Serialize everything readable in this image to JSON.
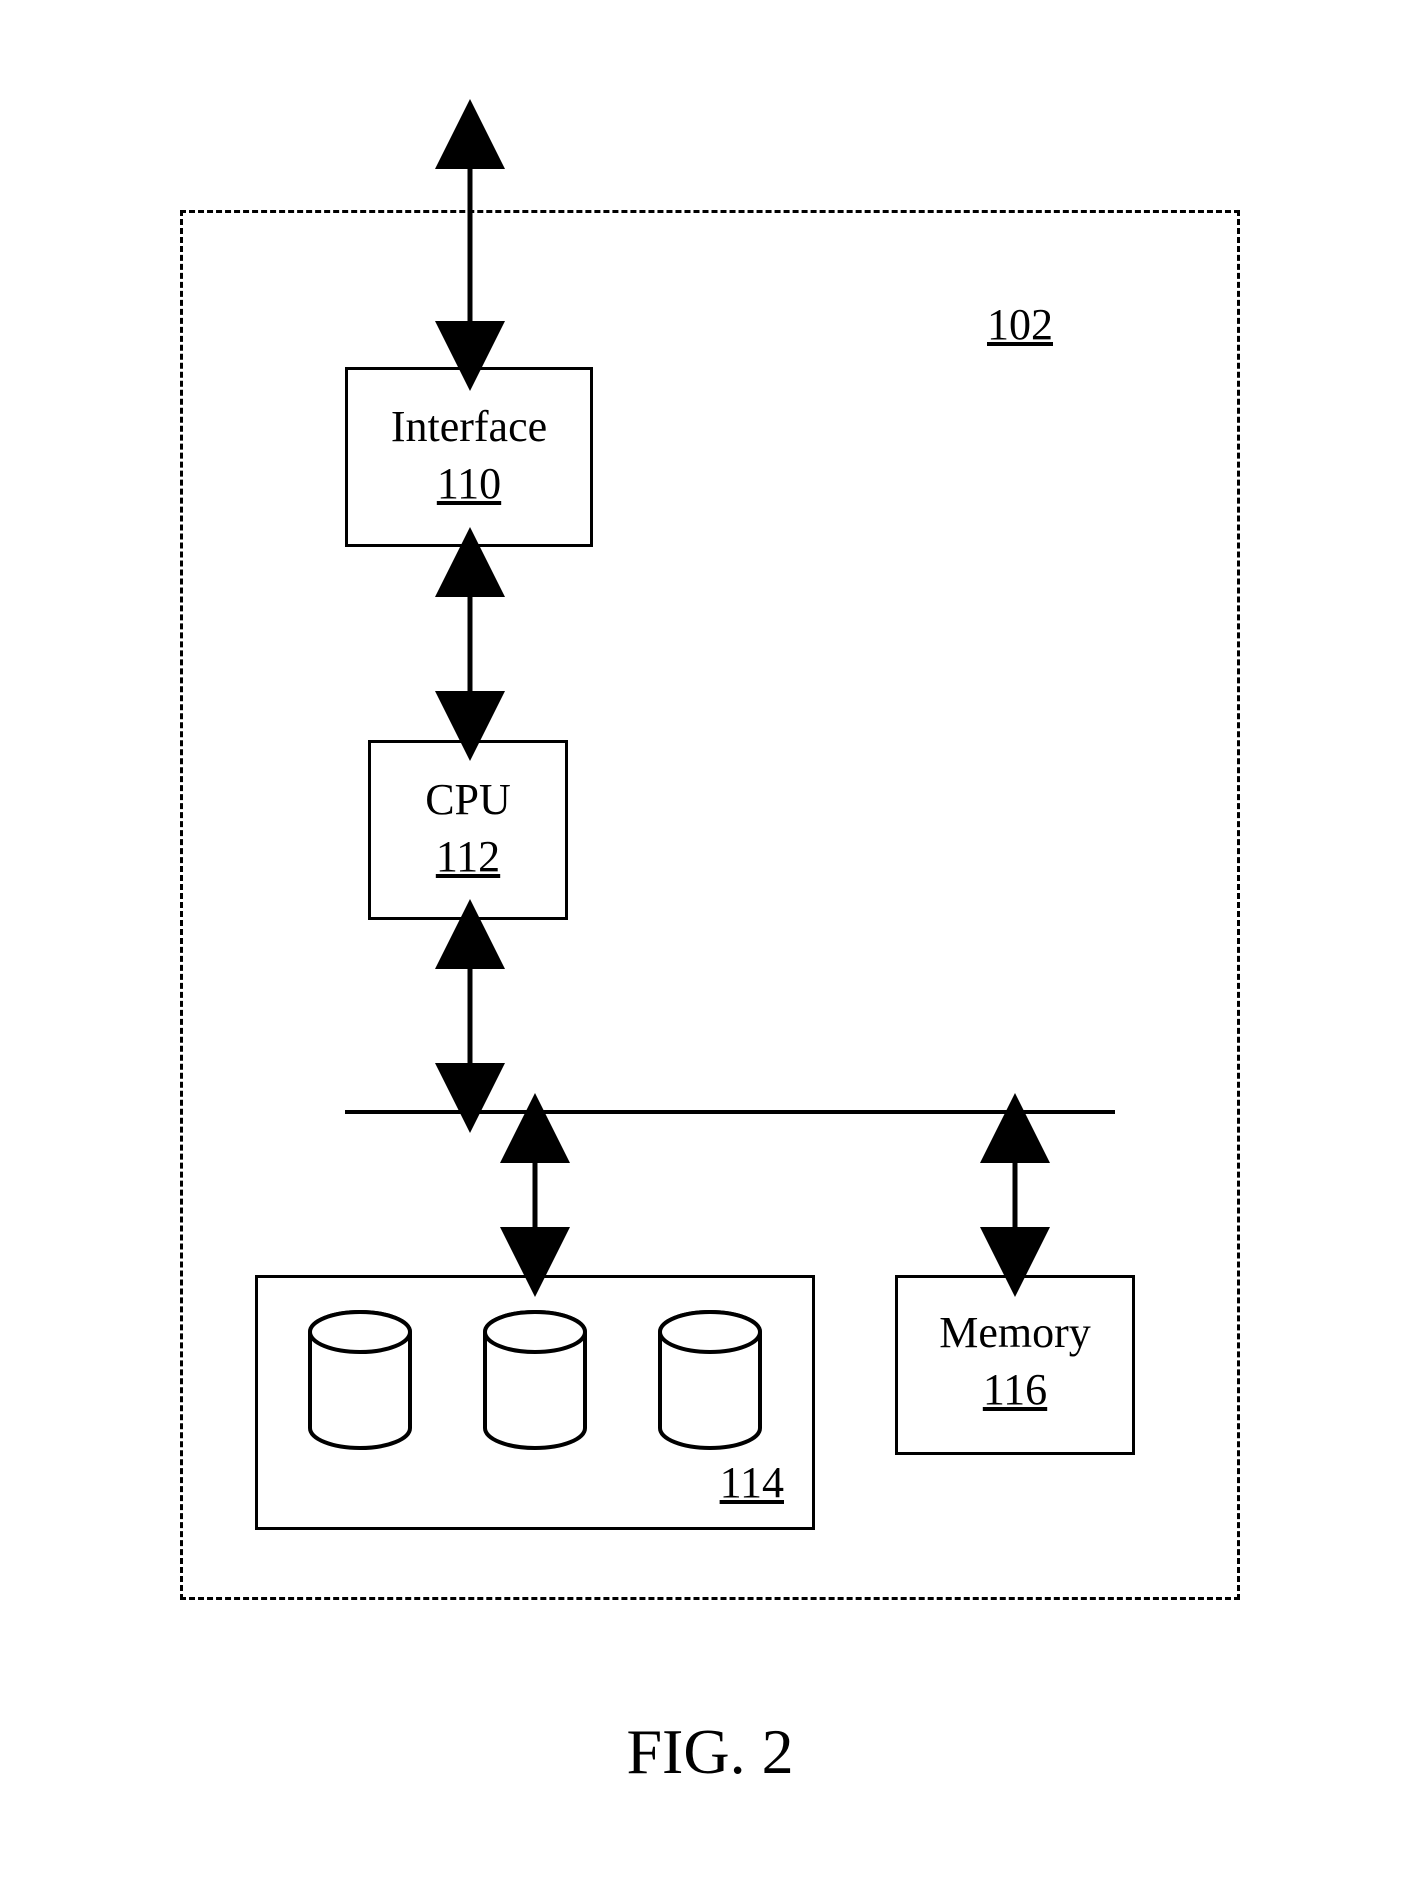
{
  "diagram": {
    "outer_ref": "102",
    "blocks": {
      "interface": {
        "title": "Interface",
        "ref": "110"
      },
      "cpu": {
        "title": "CPU",
        "ref": "112"
      },
      "storage": {
        "ref": "114"
      },
      "memory": {
        "title": "Memory",
        "ref": "116"
      }
    },
    "caption": "FIG. 2"
  }
}
